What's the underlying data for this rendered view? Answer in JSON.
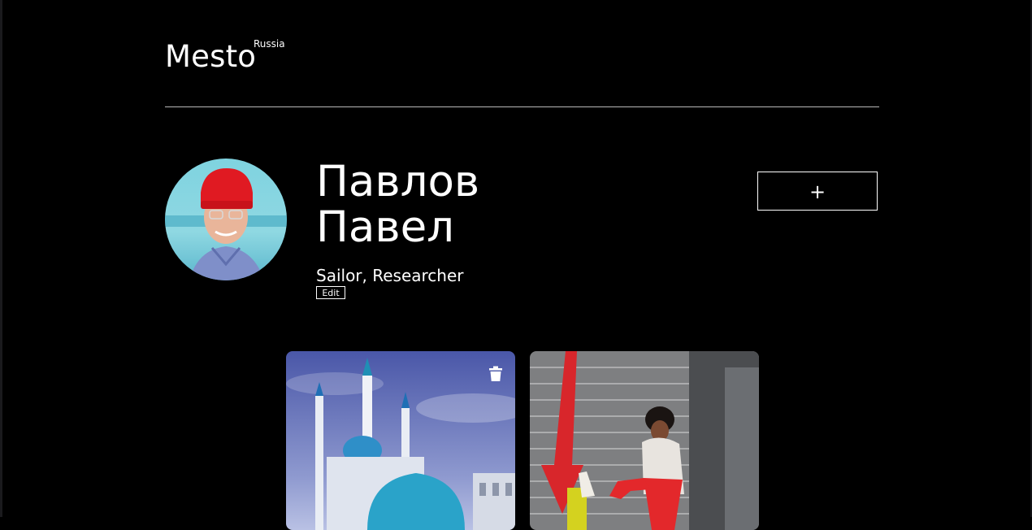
{
  "header": {
    "logo": "Mesto",
    "logo_sup": "Russia"
  },
  "profile": {
    "name": "Павлов\nПавел",
    "about": "Sailor, Researcher",
    "edit_label": "Edit",
    "add_label": "+"
  },
  "cards": [
    {
      "icon": "trash-icon"
    },
    {
      "icon": ""
    }
  ],
  "colors": {
    "background": "#000000",
    "text": "#ffffff",
    "divider": "#b8b8b8"
  }
}
